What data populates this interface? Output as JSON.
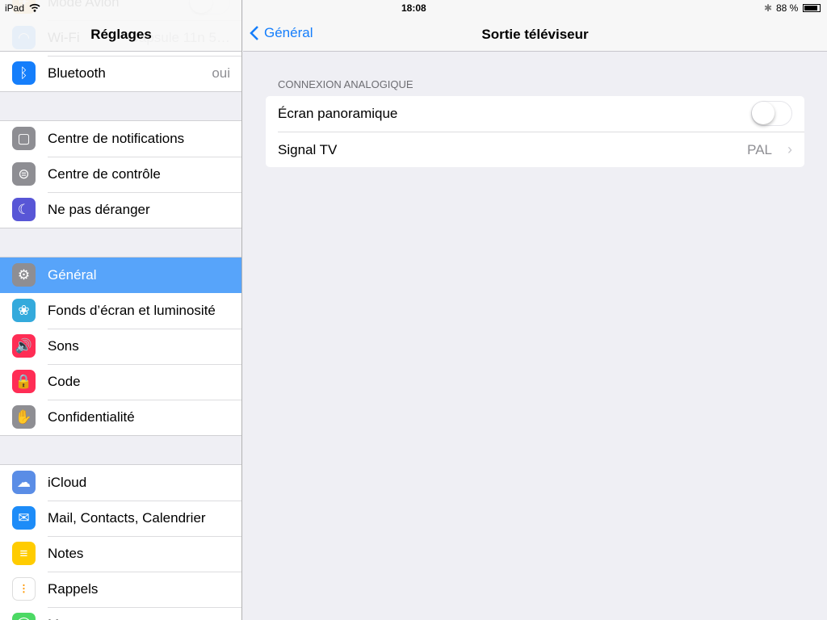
{
  "status": {
    "device": "iPad",
    "time": "18:08",
    "battery": "88 %",
    "battery_level": 0.88
  },
  "sidebar": {
    "title": "Réglages",
    "groups": [
      [
        {
          "label": "Mode Avion",
          "icon": "airplane-icon",
          "color": "#f7a21b",
          "toggle": true
        },
        {
          "label": "Wi-Fi",
          "value": "Capsule 11n 5…",
          "icon": "wifi-icon",
          "color": "#157efb"
        },
        {
          "label": "Bluetooth",
          "value": "oui",
          "icon": "bluetooth-icon",
          "color": "#157efb"
        }
      ],
      [
        {
          "label": "Centre de notifications",
          "icon": "notifications-icon",
          "color": "#8e8e93"
        },
        {
          "label": "Centre de contrôle",
          "icon": "control-center-icon",
          "color": "#8e8e93"
        },
        {
          "label": "Ne pas déranger",
          "icon": "moon-icon",
          "color": "#5856d6"
        }
      ],
      [
        {
          "label": "Général",
          "icon": "gear-icon",
          "color": "#8e8e93",
          "selected": true
        },
        {
          "label": "Fonds d’écran et luminosité",
          "icon": "flower-icon",
          "color": "#34aadc"
        },
        {
          "label": "Sons",
          "icon": "speaker-icon",
          "color": "#ff2d55"
        },
        {
          "label": "Code",
          "icon": "lock-icon",
          "color": "#ff2d55"
        },
        {
          "label": "Confidentialité",
          "icon": "hand-icon",
          "color": "#8e8e93"
        }
      ],
      [
        {
          "label": "iCloud",
          "icon": "cloud-icon",
          "color": "#5a8de6"
        },
        {
          "label": "Mail, Contacts, Calendrier",
          "icon": "envelope-icon",
          "color": "#1d8cf8"
        },
        {
          "label": "Notes",
          "icon": "notes-icon",
          "color": "#ffcc00"
        },
        {
          "label": "Rappels",
          "icon": "reminders-icon",
          "color": "#ffffff"
        },
        {
          "label": "Messages",
          "icon": "messages-icon",
          "color": "#4cd964"
        }
      ]
    ]
  },
  "main": {
    "back_label": "Général",
    "title": "Sortie téléviseur",
    "section": "CONNEXION ANALOGIQUE",
    "rows": [
      {
        "label": "Écran panoramique",
        "toggle": false
      },
      {
        "label": "Signal TV",
        "value": "PAL"
      }
    ]
  }
}
